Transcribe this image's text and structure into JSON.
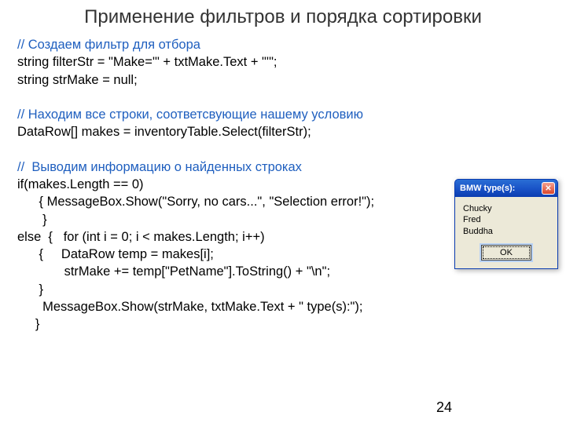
{
  "title": "Применение фильтров и порядка сортировки",
  "code": {
    "c1": "// Создаем фильтр для отбора",
    "l1": "string filterStr = \"Make='\" + txtMake.Text + \"'\";",
    "l2": "string strMake = null;",
    "c2": "// Находим все строки, соответсвующие нашему условию",
    "l3": "DataRow[] makes = inventoryTable.Select(filterStr);",
    "c3": "//  Выводим информацию о найденных строках",
    "l4": "if(makes.Length == 0)",
    "l5": "      { MessageBox.Show(\"Sorry, no cars...\", \"Selection error!\");",
    "l6": "       }",
    "l7": "else  {   for (int i = 0; i < makes.Length; i++)",
    "l8": "      {     DataRow temp = makes[i];",
    "l9": "             strMake += temp[\"PetName\"].ToString() + \"\\n\";",
    "l10": "      }",
    "l11": "       MessageBox.Show(strMake, txtMake.Text + \" type(s):\");",
    "l12": "     }"
  },
  "msgbox": {
    "title": "BMW type(s):",
    "lines": [
      "Chucky",
      "Fred",
      "Buddha"
    ],
    "ok": "OK"
  },
  "page": "24"
}
